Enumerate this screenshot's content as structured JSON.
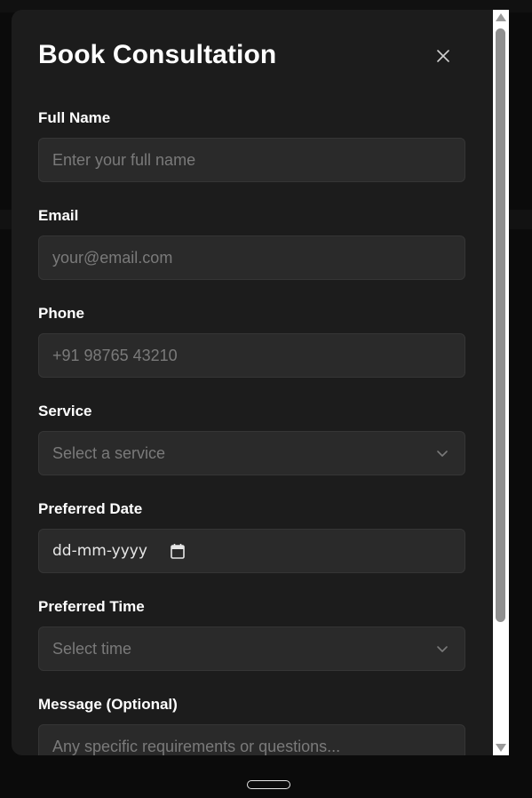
{
  "dialog": {
    "title": "Book Consultation"
  },
  "form": {
    "full_name": {
      "label": "Full Name",
      "placeholder": "Enter your full name"
    },
    "email": {
      "label": "Email",
      "placeholder": "your@email.com"
    },
    "phone": {
      "label": "Phone",
      "placeholder": "+91 98765 43210"
    },
    "service": {
      "label": "Service",
      "selected": "Select a service"
    },
    "date": {
      "label": "Preferred Date",
      "value": "dd-mm-yyyy"
    },
    "time": {
      "label": "Preferred Time",
      "selected": "Select time"
    },
    "message": {
      "label": "Message (Optional)",
      "placeholder": "Any specific requirements or questions..."
    }
  },
  "icons": {
    "close": "close-icon",
    "service_chevron": "chevron-down-icon",
    "time_chevron": "chevron-down-icon",
    "calendar": "calendar-icon"
  },
  "colors": {
    "modal_bg": "#1c1c1c",
    "field_bg": "#2a2a2a",
    "text": "#ffffff",
    "placeholder": "#7a7a7a"
  }
}
